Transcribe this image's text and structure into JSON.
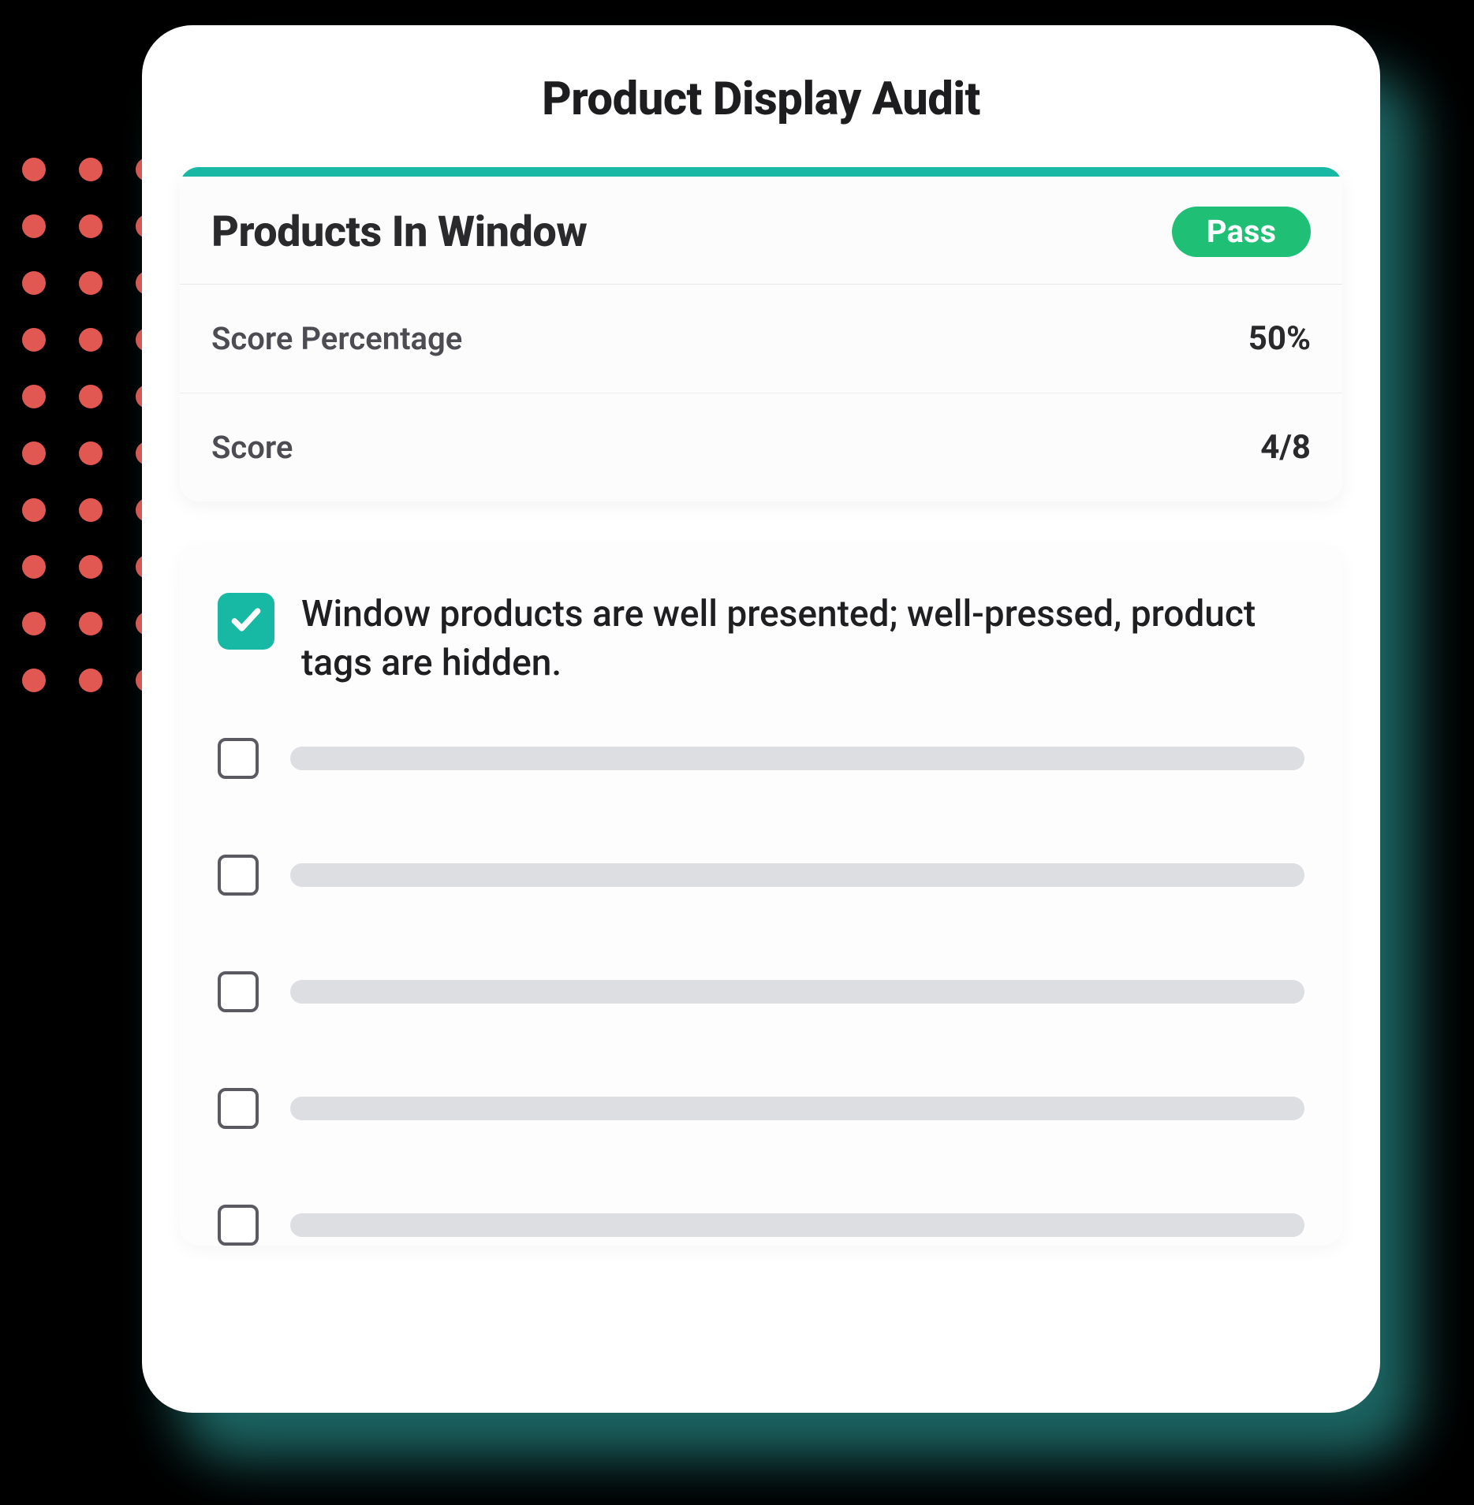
{
  "header": {
    "title": "Product Display Audit"
  },
  "summary": {
    "section_title": "Products In Window",
    "badge_label": "Pass",
    "rows": [
      {
        "label": "Score Percentage",
        "value": "50%"
      },
      {
        "label": "Score",
        "value": "4/8"
      }
    ]
  },
  "checklist": {
    "items": [
      {
        "checked": true,
        "text": "Window products are well presented; well-pressed, product tags are hidden."
      }
    ],
    "placeholder_count": 5
  },
  "colors": {
    "accent_teal": "#18b8a4",
    "pass_green": "#1fbf75",
    "dot_red": "#e15751"
  }
}
